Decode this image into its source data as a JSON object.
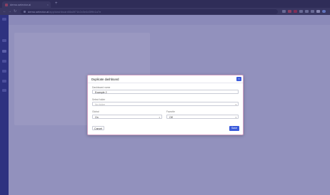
{
  "browser": {
    "tab_title": "demo.selector.ai",
    "tab_close": "×",
    "new_tab": "+",
    "url_host": "demo.selector.ai",
    "url_path": "/app/dashboard/8a8f71b2c0e4d3f9b1a7e",
    "back": "←",
    "forward": "→",
    "reload": "↻"
  },
  "dialog": {
    "title": "Duplicate dashboard",
    "close_glyph": "×",
    "name_label": "Dashboard name",
    "name_value": "Example 2",
    "folder_label": "Select folder",
    "folder_placeholder": "No folder",
    "global_label": "Global",
    "global_value": "On",
    "favorite_label": "Favorite",
    "favorite_value": "Off",
    "cancel_label": "Cancel",
    "save_label": "Save"
  }
}
